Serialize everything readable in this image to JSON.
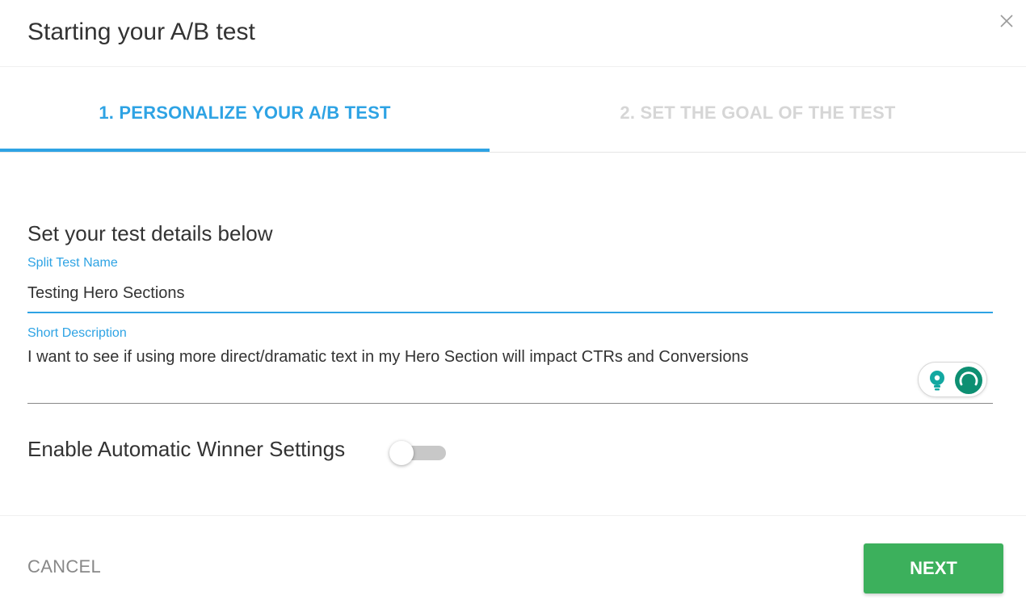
{
  "dialog": {
    "title": "Starting your A/B test",
    "close_icon": "close-icon"
  },
  "tabs": [
    {
      "label": "1. PERSONALIZE YOUR A/B TEST",
      "active": true
    },
    {
      "label": "2. SET THE GOAL OF THE TEST",
      "active": false
    }
  ],
  "form": {
    "heading": "Set your test details below",
    "name_label": "Split Test Name",
    "name_value": "Testing Hero Sections",
    "description_label": "Short Description",
    "description_value": "I want to see if using more direct/dramatic text in my Hero Section will impact CTRs and Conversions",
    "auto_winner_label": "Enable Automatic Winner Settings",
    "auto_winner_enabled": false
  },
  "widget": {
    "icons": [
      "lightbulb-icon",
      "grammar-assistant-icon"
    ]
  },
  "footer": {
    "cancel_label": "CANCEL",
    "next_label": "NEXT"
  },
  "colors": {
    "accent": "#2ea3e4",
    "primary_button": "#3cb05c",
    "inactive_tab": "#d6d6d6",
    "assistant": "#0d8f72"
  }
}
